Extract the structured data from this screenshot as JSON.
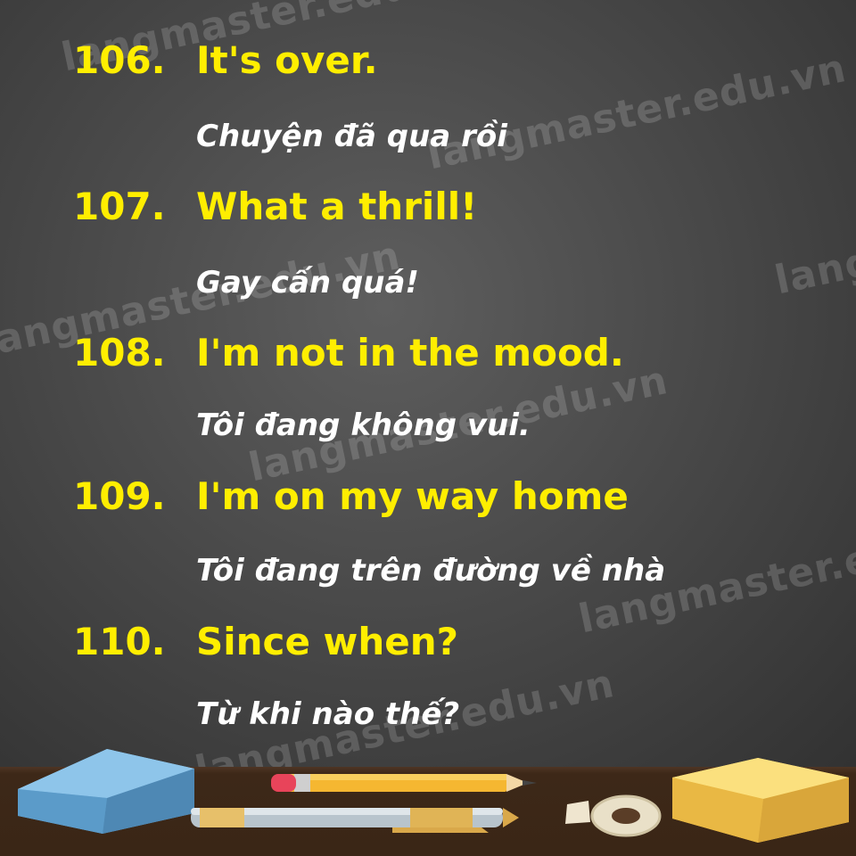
{
  "watermark": "langmaster.edu.vn",
  "phrases": [
    {
      "number": "106.",
      "english": "It's over.",
      "vietnamese": "Chuyện đã qua rồi"
    },
    {
      "number": "107.",
      "english": "What a thrill!",
      "vietnamese": "Gay cấn quá!"
    },
    {
      "number": "108.",
      "english": "I'm not in the mood.",
      "vietnamese": "Tôi đang không vui."
    },
    {
      "number": "109.",
      "english": "I'm on my way home",
      "vietnamese": "Tôi đang trên đường về nhà"
    },
    {
      "number": "110.",
      "english": "Since when?",
      "vietnamese": "Từ khi nào thế?"
    }
  ],
  "colors": {
    "heading_yellow": "#ffee00",
    "translation_white": "#ffffff",
    "board": "#4a4a4a",
    "desk": "#3d2818"
  },
  "desk_items": [
    "blue-sticky-note-pad-icon",
    "pencil-icon",
    "pen-icon",
    "tape-roll-icon",
    "yellow-sticky-note-pad-icon"
  ]
}
